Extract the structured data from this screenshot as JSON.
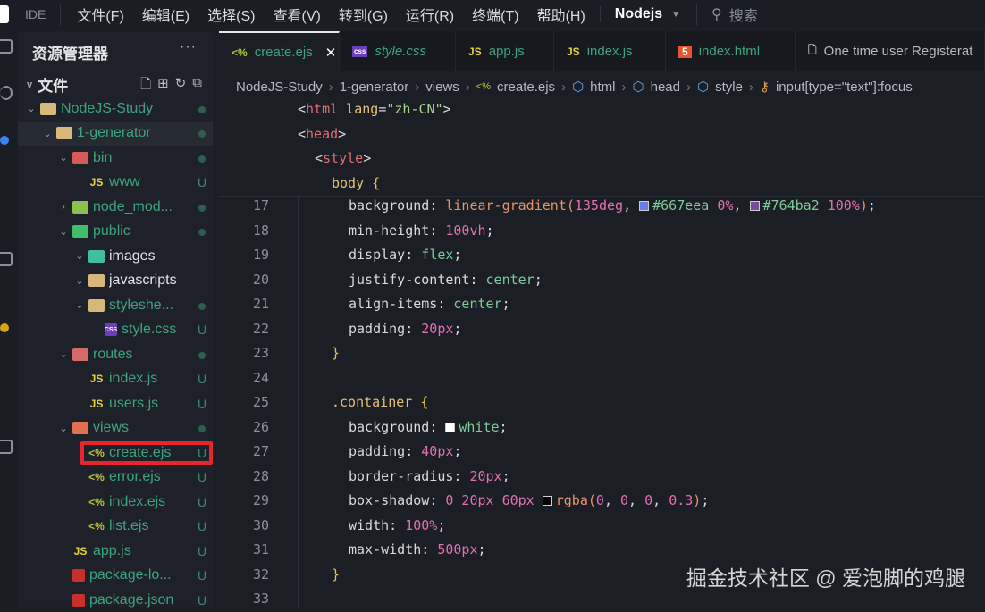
{
  "menubar": {
    "ide": "IDE",
    "items": [
      "文件(F)",
      "编辑(E)",
      "选择(S)",
      "查看(V)",
      "转到(G)",
      "运行(R)",
      "终端(T)",
      "帮助(H)"
    ],
    "project": "Nodejs",
    "search_placeholder": "搜索"
  },
  "sidebar": {
    "title": "资源管理器",
    "more": "···",
    "section": "文件",
    "tree": [
      {
        "label": "NodeJS-Study",
        "level": 0,
        "chev": "v",
        "icon": "folder",
        "status": "dot",
        "color": "#3fa37f"
      },
      {
        "label": "1-generator",
        "level": 1,
        "chev": "v",
        "icon": "folder",
        "status": "dot",
        "color": "#3fa37f",
        "selected": true
      },
      {
        "label": "bin",
        "level": 2,
        "chev": "v",
        "icon": "folder-bin",
        "status": "dot",
        "color": "#3fa37f"
      },
      {
        "label": "www",
        "level": 3,
        "chev": "",
        "icon": "js",
        "status": "U",
        "color": "#3fa37f"
      },
      {
        "label": "node_mod...",
        "level": 2,
        "chev": ">",
        "icon": "folder-node",
        "status": "dot",
        "color": "#3fa37f"
      },
      {
        "label": "public",
        "level": 2,
        "chev": "v",
        "icon": "folder-public",
        "status": "dot",
        "color": "#3fa37f"
      },
      {
        "label": "images",
        "level": 3,
        "chev": "v",
        "icon": "folder-images",
        "status": "",
        "color": "#e3e5e9"
      },
      {
        "label": "javascripts",
        "level": 3,
        "chev": "v",
        "icon": "folder",
        "status": "",
        "color": "#e3e5e9"
      },
      {
        "label": "styleshe...",
        "level": 3,
        "chev": "v",
        "icon": "folder",
        "status": "dot",
        "color": "#3fa37f"
      },
      {
        "label": "style.css",
        "level": 4,
        "chev": "",
        "icon": "css",
        "status": "U",
        "color": "#3fa37f"
      },
      {
        "label": "routes",
        "level": 2,
        "chev": "v",
        "icon": "folder-routes",
        "status": "dot",
        "color": "#3fa37f"
      },
      {
        "label": "index.js",
        "level": 3,
        "chev": "",
        "icon": "js",
        "status": "U",
        "color": "#3fa37f"
      },
      {
        "label": "users.js",
        "level": 3,
        "chev": "",
        "icon": "js",
        "status": "U",
        "color": "#3fa37f"
      },
      {
        "label": "views",
        "level": 2,
        "chev": "v",
        "icon": "folder-views",
        "status": "dot",
        "color": "#3fa37f"
      },
      {
        "label": "create.ejs",
        "level": 3,
        "chev": "",
        "icon": "ejs",
        "status": "U",
        "color": "#3fa37f",
        "highlighted": true
      },
      {
        "label": "error.ejs",
        "level": 3,
        "chev": "",
        "icon": "ejs",
        "status": "U",
        "color": "#3fa37f"
      },
      {
        "label": "index.ejs",
        "level": 3,
        "chev": "",
        "icon": "ejs",
        "status": "U",
        "color": "#3fa37f"
      },
      {
        "label": "list.ejs",
        "level": 3,
        "chev": "",
        "icon": "ejs",
        "status": "U",
        "color": "#3fa37f"
      },
      {
        "label": "app.js",
        "level": 2,
        "chev": "",
        "icon": "js",
        "status": "U",
        "color": "#3fa37f"
      },
      {
        "label": "package-lo...",
        "level": 2,
        "chev": "",
        "icon": "npm",
        "status": "U",
        "color": "#3fa37f"
      },
      {
        "label": "package.json",
        "level": 2,
        "chev": "",
        "icon": "npm",
        "status": "U",
        "color": "#3fa37f"
      }
    ]
  },
  "tabs": [
    {
      "label": "create.ejs",
      "icon": "ejs",
      "active": true,
      "italic": false
    },
    {
      "label": "style.css",
      "icon": "css",
      "italic": true
    },
    {
      "label": "app.js",
      "icon": "js"
    },
    {
      "label": "index.js",
      "icon": "js"
    },
    {
      "label": "index.html",
      "icon": "html5"
    },
    {
      "label": "One time user Registerat",
      "icon": "file",
      "color": "#b5b9c1"
    }
  ],
  "breadcrumb": [
    "NodeJS-Study",
    "1-generator",
    "views",
    "create.ejs",
    "html",
    "head",
    "style",
    "input[type=\"text\"]:focus"
  ],
  "sticky_lines": [
    {
      "indent": 0,
      "tokens": [
        [
          "x",
          "<"
        ],
        [
          "tag",
          "html"
        ],
        [
          "x",
          " "
        ],
        [
          "a",
          "lang"
        ],
        [
          "x",
          "="
        ],
        [
          "s",
          "\"zh-CN\""
        ],
        [
          "x",
          ">"
        ]
      ]
    },
    {
      "indent": 0,
      "tokens": [
        [
          "x",
          "<"
        ],
        [
          "tag",
          "head"
        ],
        [
          "x",
          ">"
        ]
      ]
    },
    {
      "indent": 1,
      "tokens": [
        [
          "x",
          "<"
        ],
        [
          "tag",
          "style"
        ],
        [
          "x",
          ">"
        ]
      ]
    },
    {
      "indent": 2,
      "tokens": [
        [
          "a",
          "body"
        ],
        [
          "x",
          " "
        ],
        [
          "b",
          "{"
        ]
      ]
    }
  ],
  "code_lines": [
    {
      "n": "17",
      "indent": 3,
      "tokens": [
        [
          "p",
          "background"
        ],
        [
          "x",
          ": "
        ],
        [
          "f",
          "linear-gradient("
        ],
        [
          "n",
          "135deg"
        ],
        [
          "x",
          ", "
        ],
        [
          "sw",
          "#667eea"
        ],
        [
          "v",
          "#667eea"
        ],
        [
          "x",
          " "
        ],
        [
          "n",
          "0%"
        ],
        [
          "x",
          ", "
        ],
        [
          "sw",
          "#764ba2"
        ],
        [
          "v",
          "#764ba2"
        ],
        [
          "x",
          " "
        ],
        [
          "n",
          "100%"
        ],
        [
          "f",
          ")"
        ],
        [
          "x",
          ";"
        ]
      ]
    },
    {
      "n": "18",
      "indent": 3,
      "tokens": [
        [
          "p",
          "min-height"
        ],
        [
          "x",
          ": "
        ],
        [
          "n",
          "100vh"
        ],
        [
          "x",
          ";"
        ]
      ]
    },
    {
      "n": "19",
      "indent": 3,
      "tokens": [
        [
          "p",
          "display"
        ],
        [
          "x",
          ": "
        ],
        [
          "v",
          "flex"
        ],
        [
          "x",
          ";"
        ]
      ]
    },
    {
      "n": "20",
      "indent": 3,
      "tokens": [
        [
          "p",
          "justify-content"
        ],
        [
          "x",
          ": "
        ],
        [
          "v",
          "center"
        ],
        [
          "x",
          ";"
        ]
      ]
    },
    {
      "n": "21",
      "indent": 3,
      "tokens": [
        [
          "p",
          "align-items"
        ],
        [
          "x",
          ": "
        ],
        [
          "v",
          "center"
        ],
        [
          "x",
          ";"
        ]
      ]
    },
    {
      "n": "22",
      "indent": 3,
      "tokens": [
        [
          "p",
          "padding"
        ],
        [
          "x",
          ": "
        ],
        [
          "n",
          "20px"
        ],
        [
          "x",
          ";"
        ]
      ]
    },
    {
      "n": "23",
      "indent": 2,
      "tokens": [
        [
          "b",
          "}"
        ]
      ]
    },
    {
      "n": "24",
      "indent": 0,
      "tokens": []
    },
    {
      "n": "25",
      "indent": 2,
      "tokens": [
        [
          "a",
          ".container"
        ],
        [
          "x",
          " "
        ],
        [
          "b",
          "{"
        ]
      ]
    },
    {
      "n": "26",
      "indent": 3,
      "tokens": [
        [
          "p",
          "background"
        ],
        [
          "x",
          ": "
        ],
        [
          "sw",
          "#ffffff"
        ],
        [
          "v",
          "white"
        ],
        [
          "x",
          ";"
        ]
      ]
    },
    {
      "n": "27",
      "indent": 3,
      "tokens": [
        [
          "p",
          "padding"
        ],
        [
          "x",
          ": "
        ],
        [
          "n",
          "40px"
        ],
        [
          "x",
          ";"
        ]
      ]
    },
    {
      "n": "28",
      "indent": 3,
      "tokens": [
        [
          "p",
          "border-radius"
        ],
        [
          "x",
          ": "
        ],
        [
          "n",
          "20px"
        ],
        [
          "x",
          ";"
        ]
      ]
    },
    {
      "n": "29",
      "indent": 3,
      "tokens": [
        [
          "p",
          "box-shadow"
        ],
        [
          "x",
          ": "
        ],
        [
          "n",
          "0 20px 60px"
        ],
        [
          "x",
          " "
        ],
        [
          "sw",
          "#000000"
        ],
        [
          "f",
          "rgba("
        ],
        [
          "n",
          "0"
        ],
        [
          "x",
          ", "
        ],
        [
          "n",
          "0"
        ],
        [
          "x",
          ", "
        ],
        [
          "n",
          "0"
        ],
        [
          "x",
          ", "
        ],
        [
          "n",
          "0.3"
        ],
        [
          "f",
          ")"
        ],
        [
          "x",
          ";"
        ]
      ]
    },
    {
      "n": "30",
      "indent": 3,
      "tokens": [
        [
          "p",
          "width"
        ],
        [
          "x",
          ": "
        ],
        [
          "n",
          "100%"
        ],
        [
          "x",
          ";"
        ]
      ]
    },
    {
      "n": "31",
      "indent": 3,
      "tokens": [
        [
          "p",
          "max-width"
        ],
        [
          "x",
          ": "
        ],
        [
          "n",
          "500px"
        ],
        [
          "x",
          ";"
        ]
      ]
    },
    {
      "n": "32",
      "indent": 2,
      "tokens": [
        [
          "b",
          "}"
        ]
      ]
    },
    {
      "n": "33",
      "indent": 0,
      "tokens": []
    }
  ],
  "watermark": "掘金技术社区 @ 爱泡脚的鸡腿",
  "colors": {
    "editor_bg": "#1b1e25",
    "sidebar_bg": "#1e2129",
    "git_untracked": "#3fa37f",
    "highlight_box": "#e8252b"
  }
}
